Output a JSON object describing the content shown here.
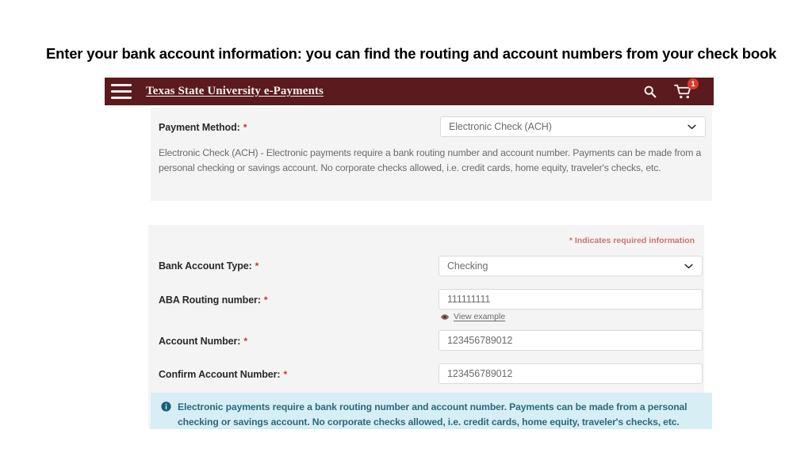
{
  "slide": {
    "heading": "Enter your bank account information: you can find the routing and account numbers from your check book"
  },
  "header": {
    "title": "Texas State University e-Payments",
    "menu_icon": "hamburger-menu-icon",
    "search_icon": "search-icon",
    "cart_icon": "shopping-cart-icon",
    "cart_badge_count": "1",
    "background_color": "#5b1a1e"
  },
  "payment_method_panel": {
    "label": "Payment Method:",
    "required_marker": "*",
    "selected_value": "Electronic Check (ACH)",
    "description": "Electronic Check (ACH) - Electronic payments require a bank routing number and account number. Payments can be made from a personal checking or savings account. No corporate checks allowed, i.e. credit cards, home equity, traveler's checks, etc."
  },
  "bank_panel": {
    "required_note": "* Indicates required information",
    "required_note_color": "#c9756a",
    "fields": [
      {
        "label": "Bank Account Type:",
        "required_marker": "*",
        "value": "Checking",
        "type": "select"
      },
      {
        "label": "ABA Routing number:",
        "required_marker": "*",
        "value": "111111111",
        "type": "text"
      },
      {
        "label": "Account Number:",
        "required_marker": "*",
        "value": "123456789012",
        "type": "text"
      },
      {
        "label": "Confirm Account Number:",
        "required_marker": "*",
        "value": "123456789012",
        "type": "text"
      }
    ],
    "view_example": {
      "label": "View example",
      "icon": "eye-icon"
    }
  },
  "info_alert": {
    "icon": "info-circle-icon",
    "text": "Electronic payments require a bank routing number and account number. Payments can be made from a personal checking or savings account. No corporate checks allowed, i.e. credit cards, home equity, traveler's checks, etc.",
    "background_color": "#d7eef5"
  },
  "chat_widget": {
    "icon": "chat-bubble-icon"
  }
}
